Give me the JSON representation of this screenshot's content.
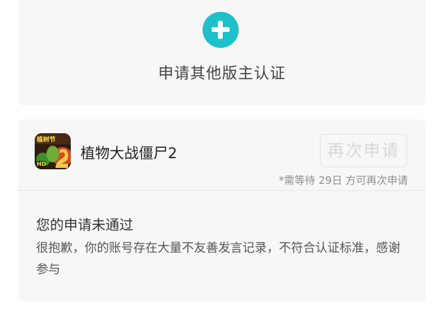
{
  "apply_card": {
    "icon": "plus-icon",
    "accent_color": "#1ec0c9",
    "label": "申请其他版主认证"
  },
  "status_card": {
    "game": {
      "icon": "plants-vs-zombies-2-game-icon",
      "icon_badge": "植树节",
      "icon_corner": "HD",
      "name": "植物大战僵尸2"
    },
    "reapply_button": "再次申请",
    "wait_note": "*需等待 29日 方可再次申请",
    "result_title": "您的申请未通过",
    "result_reason": "很抱歉，你的账号存在大量不友善发言记录，不符合认证标准，感谢参与"
  }
}
